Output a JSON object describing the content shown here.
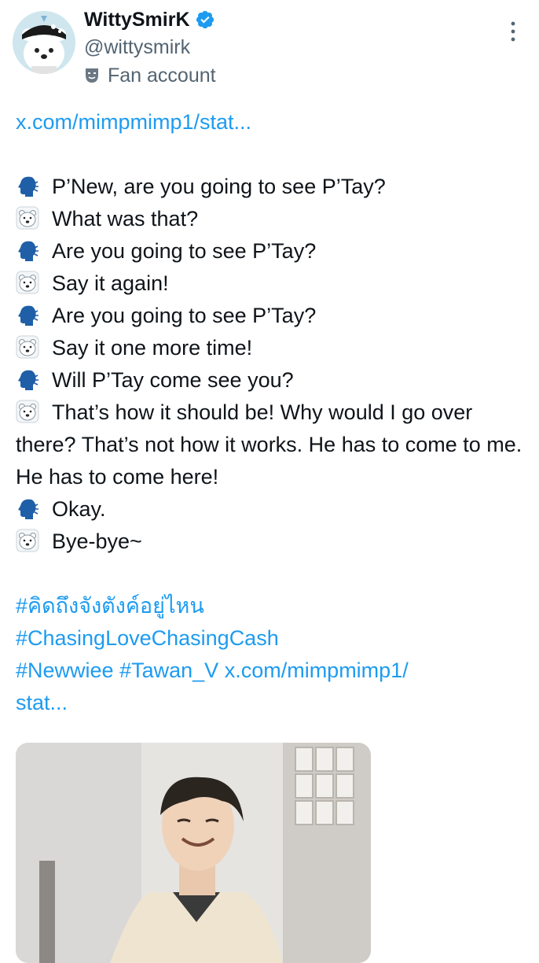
{
  "author": {
    "display_name": "WittySmirK",
    "handle": "@wittysmirk",
    "label": "Fan account",
    "avatar_icon": "bear-avatar",
    "verified_icon": "verified-badge-icon",
    "label_icon": "theater-mask-icon"
  },
  "menu_icon": "more-vertical-icon",
  "tweet": {
    "link_top": "x.com/mimpmimp1/stat...",
    "dialogue": [
      {
        "icon": "speaking-head-icon",
        "text": "P’New, are you going to see P’Tay?"
      },
      {
        "icon": "polar-bear-icon",
        "text": "What was that?"
      },
      {
        "icon": "speaking-head-icon",
        "text": "Are you going to see P’Tay?"
      },
      {
        "icon": "polar-bear-icon",
        "text": "Say it again!"
      },
      {
        "icon": "speaking-head-icon",
        "text": "Are you going to see P’Tay?"
      },
      {
        "icon": "polar-bear-icon",
        "text": "Say it one more time!"
      },
      {
        "icon": "speaking-head-icon",
        "text": "Will P’Tay come see you?"
      },
      {
        "icon": "polar-bear-icon",
        "text": "That’s how it should be! Why would I go over there? That’s not how it works. He has to come to me. He has to come here!"
      },
      {
        "icon": "speaking-head-icon",
        "text": "Okay."
      },
      {
        "icon": "polar-bear-icon",
        "text": "Bye-bye~"
      }
    ],
    "hashtags": {
      "tag1": "#คิดถึงจังตังค์อยู่ไหน",
      "tag2": "#ChasingLoveChasingCash",
      "tag3": "#Newwiee",
      "tag4": "#Tawan_V",
      "link_bottom_part1": "x.com/mimpmimp1/",
      "link_bottom_part2": "stat..."
    }
  },
  "media": {
    "type": "video-thumbnail"
  },
  "colors": {
    "link": "#1d9bf0",
    "text": "#0f1419",
    "secondary": "#536471",
    "speaking_head": "#1f5fa8"
  }
}
